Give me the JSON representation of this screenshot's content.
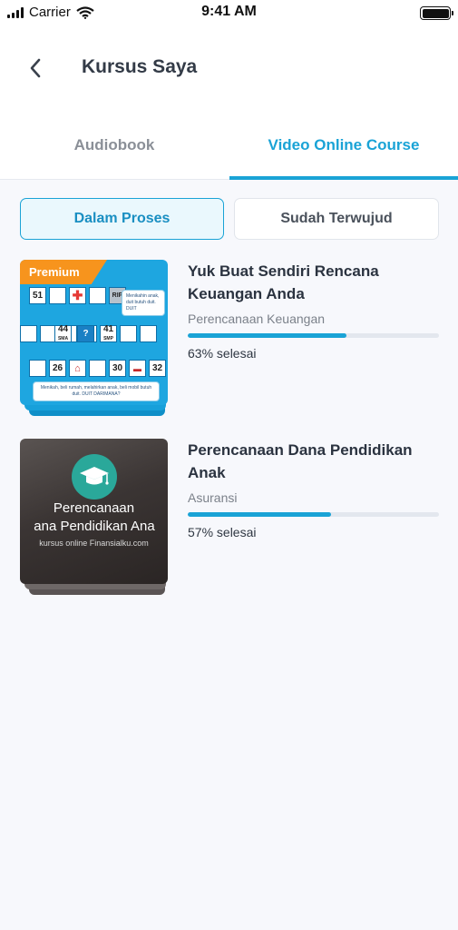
{
  "status_bar": {
    "carrier": "Carrier",
    "time": "9:41 AM"
  },
  "header": {
    "title": "Kursus Saya",
    "back_icon": "chevron-left-icon"
  },
  "tabs": [
    {
      "label": "Audiobook",
      "active": false
    },
    {
      "label": "Video Online Course",
      "active": true
    }
  ],
  "filters": [
    {
      "label": "Dalam Proses",
      "selected": true
    },
    {
      "label": "Sudah Terwujud",
      "selected": false
    }
  ],
  "courses": [
    {
      "title": "Yuk Buat Sendiri Rencana Keuangan Anda",
      "category": "Perencanaan Keuangan",
      "progress": 0.63,
      "progress_text": "63% selesai",
      "thumbnail": {
        "badge": "Premium",
        "cells": [
          "51",
          "44",
          "41",
          "26",
          "30",
          "32"
        ],
        "cell_labels": [
          "SMA",
          "SMP",
          "RIP"
        ],
        "notes": [
          "Menikahin anak, duit butuh duit. DUIT",
          "Menikah, beli rumah, melahirkan anak, beli mobil butuh duit. DUIT DARIMANA?"
        ]
      }
    },
    {
      "title": "Perencanaan Dana Pendidikan Anak",
      "category": "Asuransi",
      "progress": 0.57,
      "progress_text": "57% selesai",
      "thumbnail": {
        "line1": "Perencanaan",
        "line2": "ana Pendidikan Ana",
        "line3": "kursus online Finansialku.com",
        "icon": "graduation-cap-icon"
      }
    }
  ],
  "colors": {
    "accent": "#1aa3d6",
    "premium": "#f7941d",
    "teal": "#2aa89a"
  }
}
